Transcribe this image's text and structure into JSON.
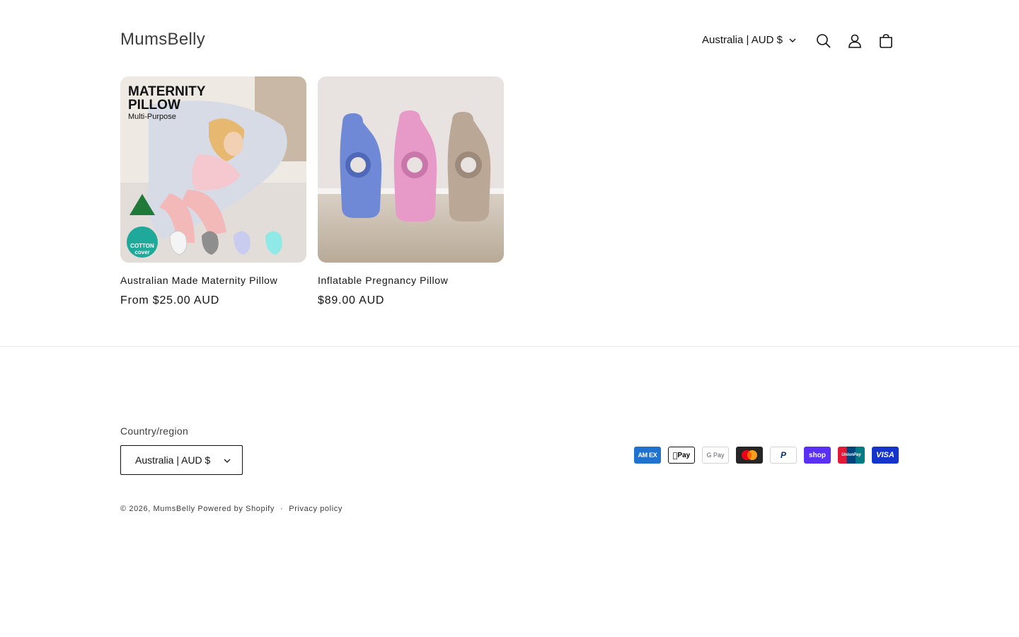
{
  "header": {
    "logo": "MumsBelly",
    "locale": "Australia | AUD $",
    "icons": [
      "search-icon",
      "account-icon",
      "cart-icon"
    ]
  },
  "products": [
    {
      "title": "Australian Made Maternity Pillow",
      "price": "From $25.00 AUD",
      "image_text": {
        "line1": "MATERNITY",
        "line2": "PILLOW",
        "line3": "Multi-Purpose",
        "badge1": "COTTON",
        "badge2": "cover"
      }
    },
    {
      "title": "Inflatable Pregnancy Pillow",
      "price": "$89.00 AUD"
    }
  ],
  "footer": {
    "country_label": "Country/region",
    "country_value": "Australia | AUD $",
    "payment_methods": [
      "American Express",
      "Apple Pay",
      "Google Pay",
      "Mastercard",
      "PayPal",
      "Shop Pay",
      "UnionPay",
      "Visa"
    ],
    "payment_icon_text": {
      "amex": "AM EX",
      "applepay": "Pay",
      "googlepay": "G Pay",
      "paypal": "P",
      "shoppay": "shop",
      "unionpay": "UnionPay",
      "visa": "VISA"
    },
    "copyright": "© 2026,",
    "brand_link": "MumsBelly",
    "powered": "Powered by Shopify",
    "separator": "·",
    "privacy": "Privacy policy"
  },
  "colors": {
    "accent_teal": "#1fa99a",
    "divider": "#e6e6e6",
    "text": "#121212"
  }
}
